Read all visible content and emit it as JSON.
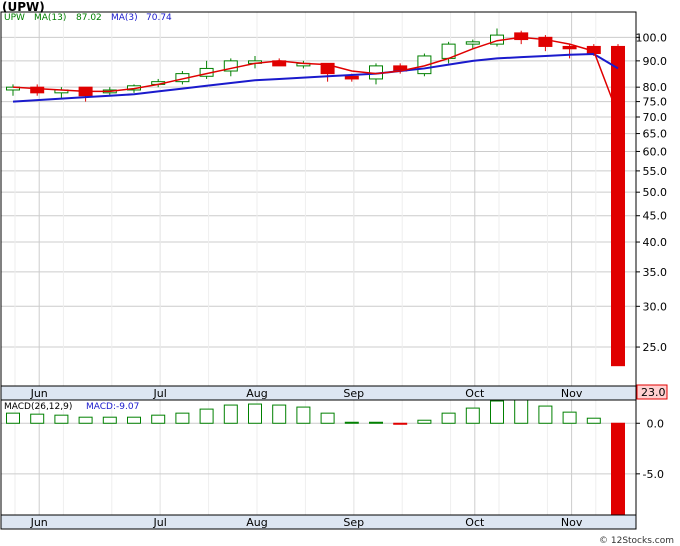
{
  "title": "(UPW)",
  "legend": {
    "symbol": "UPW",
    "ma13_label": "MA(13)",
    "ma13_value": "87.02",
    "ma3_label": "MA(3)",
    "ma3_value": "70.74"
  },
  "macd_legend": {
    "label": "MACD(26,12,9)",
    "value_label": "MACD:-9.07"
  },
  "last_price_label": "23.0",
  "credit": "© 12Stocks.com",
  "colors": {
    "up": "#008000",
    "down": "#e00000",
    "ma13": "#1a1acc",
    "ma3": "#e00000",
    "grid": "#cccccc",
    "frame": "#000000",
    "label_green": "#008000",
    "label_blue": "#1a1acc"
  },
  "chart_data": [
    {
      "type": "candlestick",
      "title": "(UPW)",
      "scale": "log",
      "ylim": [
        21,
        112
      ],
      "y_ticks": [
        "100.0",
        "90.0",
        "80.0",
        "75.0",
        "70.0",
        "65.0",
        "60.0",
        "55.0",
        "50.0",
        "45.0",
        "40.0",
        "35.0",
        "30.0",
        "25.0"
      ],
      "x_tick_labels": [
        "Jun",
        "Jul",
        "Aug",
        "Sep",
        "Oct",
        "Nov"
      ],
      "x_tick_weeks": [
        1,
        6,
        10,
        14,
        19,
        23
      ],
      "weeks": 25,
      "candles": [
        {
          "o": 79,
          "h": 81,
          "l": 77,
          "c": 80
        },
        {
          "o": 80,
          "h": 81,
          "l": 77,
          "c": 78
        },
        {
          "o": 78,
          "h": 80,
          "l": 76,
          "c": 79
        },
        {
          "o": 80,
          "h": 80,
          "l": 75,
          "c": 77
        },
        {
          "o": 78,
          "h": 80,
          "l": 77,
          "c": 79
        },
        {
          "o": 79,
          "h": 81,
          "l": 78,
          "c": 80.5
        },
        {
          "o": 81,
          "h": 83,
          "l": 80,
          "c": 82
        },
        {
          "o": 82,
          "h": 86,
          "l": 81,
          "c": 85
        },
        {
          "o": 84,
          "h": 90,
          "l": 83,
          "c": 87
        },
        {
          "o": 86,
          "h": 91,
          "l": 84,
          "c": 90
        },
        {
          "o": 89,
          "h": 92,
          "l": 87,
          "c": 90
        },
        {
          "o": 90,
          "h": 91,
          "l": 88,
          "c": 88
        },
        {
          "o": 88,
          "h": 90,
          "l": 87,
          "c": 89
        },
        {
          "o": 89,
          "h": 89,
          "l": 82,
          "c": 85
        },
        {
          "o": 84,
          "h": 85,
          "l": 82,
          "c": 83
        },
        {
          "o": 83,
          "h": 89,
          "l": 81,
          "c": 88
        },
        {
          "o": 88,
          "h": 89,
          "l": 85,
          "c": 86
        },
        {
          "o": 85,
          "h": 93,
          "l": 84,
          "c": 92
        },
        {
          "o": 91,
          "h": 98,
          "l": 89,
          "c": 97
        },
        {
          "o": 97,
          "h": 99,
          "l": 95,
          "c": 98
        },
        {
          "o": 97,
          "h": 104,
          "l": 96,
          "c": 101
        },
        {
          "o": 102,
          "h": 103,
          "l": 97,
          "c": 99
        },
        {
          "o": 100,
          "h": 101,
          "l": 94,
          "c": 96
        },
        {
          "o": 96,
          "h": 97,
          "l": 91,
          "c": 95
        },
        {
          "o": 96,
          "h": 97,
          "l": 92,
          "c": 93
        },
        {
          "o": 96,
          "h": 97,
          "l": 23,
          "c": 23
        }
      ],
      "ma13": [
        75,
        75.5,
        76,
        76.5,
        77,
        77.5,
        78.5,
        79.5,
        80.5,
        81.5,
        82.5,
        83,
        83.5,
        84,
        84.5,
        85,
        86,
        87,
        88.5,
        90,
        91,
        91.5,
        92,
        92.5,
        92.8,
        87.02
      ],
      "ma3": [
        80,
        79.5,
        79,
        78.5,
        78.5,
        79.5,
        81,
        83,
        85,
        87,
        89,
        90,
        89,
        88.5,
        86,
        85,
        86,
        88,
        91,
        95,
        98.5,
        100,
        99,
        97,
        94,
        70.74
      ]
    },
    {
      "type": "bar",
      "title": "MACD(26,12,9)",
      "ylim": [
        -9.07,
        2.3
      ],
      "y_ticks": [
        "0.0",
        "-5.0"
      ],
      "x_tick_labels": [
        "Jun",
        "Jul",
        "Aug",
        "Sep",
        "Oct",
        "Nov"
      ],
      "values": [
        1.0,
        0.9,
        0.8,
        0.6,
        0.6,
        0.6,
        0.8,
        1.0,
        1.4,
        1.8,
        1.9,
        1.8,
        1.6,
        1.0,
        0.1,
        0.1,
        -0.1,
        0.3,
        1.0,
        1.5,
        2.2,
        2.3,
        1.7,
        1.1,
        0.5,
        -9.07
      ]
    }
  ]
}
